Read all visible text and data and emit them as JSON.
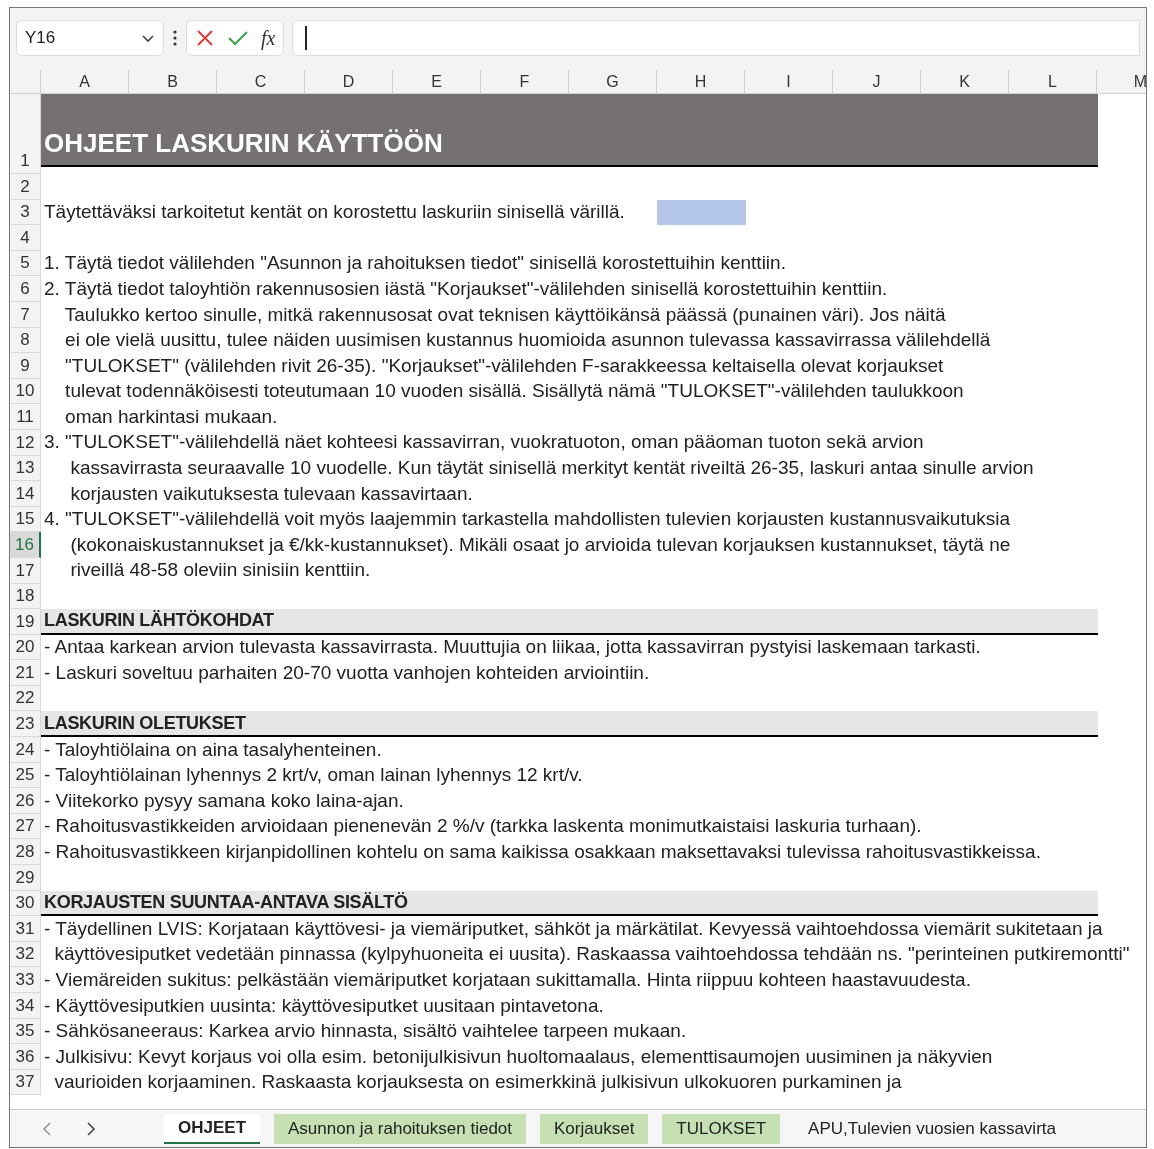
{
  "formula_bar": {
    "name_box": "Y16",
    "function_label": "fx"
  },
  "columns": [
    "A",
    "B",
    "C",
    "D",
    "E",
    "F",
    "G",
    "H",
    "I",
    "J",
    "K",
    "L",
    "M"
  ],
  "rows": [
    {
      "number": "1",
      "kind": "title",
      "text": "OHJEET LASKURIN KÄYTTÖÖN",
      "selected": false
    },
    {
      "number": "2",
      "kind": "blank",
      "selected": false
    },
    {
      "number": "3",
      "kind": "legend",
      "text": "Täytettäväksi tarkoitetut kentät on korostettu laskuriin sinisellä värillä.",
      "selected": false
    },
    {
      "number": "4",
      "kind": "blank",
      "selected": false
    },
    {
      "number": "5",
      "kind": "text",
      "text": "1. Täytä tiedot välilehden \"Asunnon ja rahoituksen tiedot\" sinisellä korostettuihin kenttiin.",
      "selected": false
    },
    {
      "number": "6",
      "kind": "text",
      "text": "2. Täytä tiedot taloyhtiön rakennusosien iästä \"Korjaukset\"-välilehden sinisellä korostettuihin kenttiin.",
      "selected": false
    },
    {
      "number": "7",
      "kind": "text",
      "text": "    Taulukko kertoo sinulle, mitkä rakennusosat ovat teknisen käyttöikänsä päässä (punainen väri). Jos näitä",
      "selected": false
    },
    {
      "number": "8",
      "kind": "text",
      "text": "    ei ole vielä uusittu, tulee näiden uusimisen kustannus huomioida asunnon tulevassa kassavirrassa välilehdellä",
      "selected": false
    },
    {
      "number": "9",
      "kind": "text",
      "text": "    \"TULOKSET\" (välilehden rivit 26-35). \"Korjaukset\"-välilehden F-sarakkeessa keltaisella olevat korjaukset",
      "selected": false
    },
    {
      "number": "10",
      "kind": "text",
      "text": "    tulevat todennäköisesti toteutumaan 10 vuoden sisällä. Sisällytä nämä \"TULOKSET\"-välilehden taulukkoon",
      "selected": false
    },
    {
      "number": "11",
      "kind": "text",
      "text": "    oman harkintasi mukaan.",
      "selected": false
    },
    {
      "number": "12",
      "kind": "text",
      "text": "3. \"TULOKSET\"-välilehdellä näet kohteesi kassavirran, vuokratuoton, oman pääoman tuoton sekä arvion",
      "selected": false
    },
    {
      "number": "13",
      "kind": "text",
      "text": "     kassavirrasta seuraavalle 10 vuodelle. Kun täytät sinisellä merkityt kentät riveiltä 26-35, laskuri antaa sinulle arvion",
      "selected": false
    },
    {
      "number": "14",
      "kind": "text",
      "text": "     korjausten vaikutuksesta tulevaan kassavirtaan.",
      "selected": false
    },
    {
      "number": "15",
      "kind": "text",
      "text": "4. \"TULOKSET\"-välilehdellä voit myös laajemmin tarkastella mahdollisten tulevien korjausten kustannusvaikutuksia",
      "selected": false
    },
    {
      "number": "16",
      "kind": "text",
      "text": "     (kokonaiskustannukset ja €/kk-kustannukset). Mikäli osaat jo arvioida tulevan korjauksen kustannukset, täytä ne",
      "selected": true
    },
    {
      "number": "17",
      "kind": "text",
      "text": "     riveillä 48-58 oleviin sinisiin kenttiin.",
      "selected": false
    },
    {
      "number": "18",
      "kind": "blank",
      "selected": false
    },
    {
      "number": "19",
      "kind": "heading",
      "text": "LASKURIN LÄHTÖKOHDAT",
      "selected": false
    },
    {
      "number": "20",
      "kind": "text",
      "text": "- Antaa karkean arvion tulevasta kassavirrasta. Muuttujia on liikaa, jotta kassavirran pystyisi laskemaan tarkasti.",
      "selected": false
    },
    {
      "number": "21",
      "kind": "text",
      "text": "- Laskuri soveltuu parhaiten 20-70 vuotta vanhojen kohteiden arviointiin.",
      "selected": false
    },
    {
      "number": "22",
      "kind": "blank",
      "selected": false
    },
    {
      "number": "23",
      "kind": "heading",
      "text": "LASKURIN OLETUKSET",
      "selected": false
    },
    {
      "number": "24",
      "kind": "text",
      "text": "- Taloyhtiölaina on aina tasalyhenteinen.",
      "selected": false
    },
    {
      "number": "25",
      "kind": "text",
      "text": "- Taloyhtiölainan lyhennys 2 krt/v, oman lainan lyhennys 12 krt/v.",
      "selected": false
    },
    {
      "number": "26",
      "kind": "text",
      "text": "- Viitekorko pysyy samana koko laina-ajan.",
      "selected": false
    },
    {
      "number": "27",
      "kind": "text",
      "text": "- Rahoitusvastikkeiden arvioidaan pienenevän 2 %/v (tarkka laskenta monimutkaistaisi laskuria turhaan).",
      "selected": false
    },
    {
      "number": "28",
      "kind": "text",
      "text": "- Rahoitusvastikkeen kirjanpidollinen kohtelu on sama kaikissa osakkaan maksettavaksi tulevissa rahoitusvastikkeissa.",
      "selected": false
    },
    {
      "number": "29",
      "kind": "blank",
      "selected": false
    },
    {
      "number": "30",
      "kind": "heading",
      "text": "KORJAUSTEN SUUNTAA-ANTAVA SISÄLTÖ",
      "selected": false
    },
    {
      "number": "31",
      "kind": "text",
      "text": "- Täydellinen LVIS: Korjataan käyttövesi- ja viemäriputket, sähköt ja märkätilat. Kevyessä vaihtoehdossa viemärit sukitetaan ja",
      "selected": false
    },
    {
      "number": "32",
      "kind": "text",
      "text": "  käyttövesiputket vedetään pinnassa (kylpyhuoneita ei uusita). Raskaassa vaihtoehdossa tehdään ns. \"perinteinen putkiremontti\"",
      "selected": false
    },
    {
      "number": "33",
      "kind": "text",
      "text": "- Viemäreiden sukitus: pelkästään viemäriputket korjataan sukittamalla. Hinta riippuu kohteen haastavuudesta.",
      "selected": false
    },
    {
      "number": "34",
      "kind": "text",
      "text": "- Käyttövesiputkien uusinta: käyttövesiputket uusitaan pintavetona.",
      "selected": false
    },
    {
      "number": "35",
      "kind": "text",
      "text": "- Sähkösaneeraus: Karkea arvio hinnasta, sisältö vaihtelee tarpeen mukaan.",
      "selected": false
    },
    {
      "number": "36",
      "kind": "text",
      "text": "- Julkisivu: Kevyt korjaus voi olla esim. betonijulkisivun huoltomaalaus, elementtisaumojen uusiminen ja näkyvien",
      "selected": false
    },
    {
      "number": "37",
      "kind": "text",
      "text": "  vaurioiden korjaaminen. Raskaasta korjauksesta on esimerkkinä julkisivun ulkokuoren purkaminen ja",
      "selected": false
    }
  ],
  "sheet_tabs": [
    {
      "label": "OHJEET",
      "selected": true
    },
    {
      "label": "Asunnon ja rahoituksen tiedot",
      "selected": false,
      "color": "#c6e0b4"
    },
    {
      "label": "Korjaukset",
      "selected": false,
      "color": "#c6e0b4"
    },
    {
      "label": "TULOKSET",
      "selected": false,
      "color": "#c6e0b4"
    },
    {
      "label": "APU,Tulevien vuosien kassavirta",
      "selected": false
    }
  ]
}
